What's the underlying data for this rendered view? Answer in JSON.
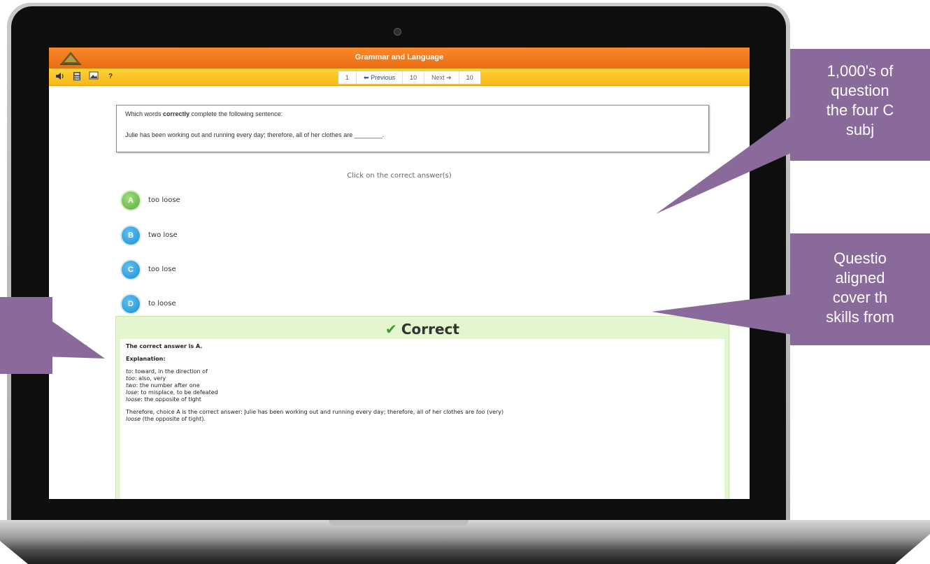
{
  "app": {
    "title": "Grammar and Language"
  },
  "toolbar": {
    "tools": [
      "speaker-icon",
      "calculator-icon",
      "image-icon",
      "help-icon"
    ],
    "help_label": "?",
    "pager": {
      "current": "1",
      "previous_label": "Previous",
      "count_left": "10",
      "next_label": "Next",
      "count_right": "10"
    }
  },
  "question": {
    "line1_prefix": "Which words ",
    "line1_bold": "correctly",
    "line1_suffix": " complete the following sentence:",
    "line2": "Julie has been working out and running every day; therefore, all of her clothes are ________."
  },
  "instruction": "Click on the correct answer(s)",
  "options": [
    {
      "letter": "A",
      "text": "too loose",
      "state": "correct"
    },
    {
      "letter": "B",
      "text": "two lose",
      "state": "default"
    },
    {
      "letter": "C",
      "text": "too lose",
      "state": "default"
    },
    {
      "letter": "D",
      "text": "to loose",
      "state": "default"
    }
  ],
  "feedback": {
    "heading": "Correct",
    "answer": "The correct answer is A.",
    "explanation_label": "Explanation:",
    "definitions": [
      {
        "term": "to",
        "meaning": ": toward, in the direction of"
      },
      {
        "term": "too",
        "meaning": ": also, very"
      },
      {
        "term": "two",
        "meaning": ": the number after one"
      },
      {
        "term": "lose",
        "meaning": ": to misplace, to be defeated"
      },
      {
        "term": "loose",
        "meaning": ": the opposite of tight"
      }
    ],
    "conclusion_1": "Therefore, choice A is the correct answer: Julie has been working out and running every day; therefore, all of her clothes are ",
    "conclusion_term1": "too",
    "conclusion_2": " (very)",
    "conclusion_term2": "loose",
    "conclusion_3": " (the opposite of tight)."
  },
  "side_id": "SMT_LA.L.11-12",
  "callouts": {
    "right_top": [
      "1,000's of",
      "question",
      "the four C",
      "subj"
    ],
    "right_mid": [
      "Questio",
      "aligned",
      "cover th",
      "skills from"
    ]
  },
  "colors": {
    "titlebar": "#ec6c12",
    "toolbar": "#f6b81a",
    "feedback_bg": "#e4f6cf",
    "callout": "#8a6a9a",
    "option_blue": "#1f8fd3",
    "option_green": "#5aaa3e"
  }
}
